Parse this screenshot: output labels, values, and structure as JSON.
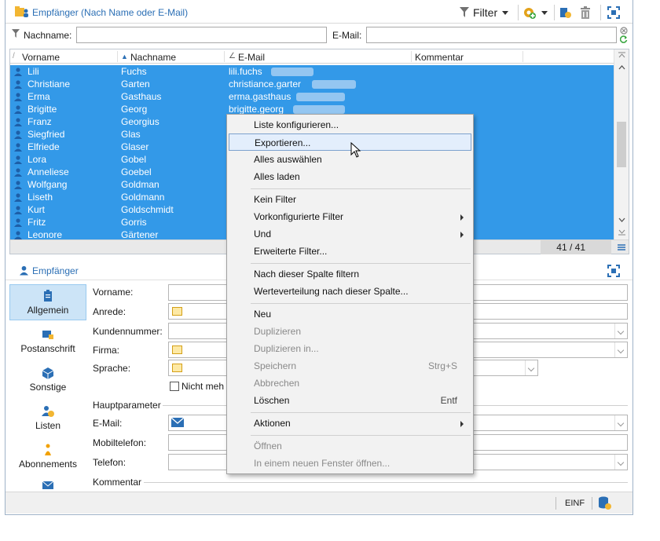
{
  "header": {
    "title": "Empfänger (Nach Name oder E-Mail)",
    "filter_label": "Filter"
  },
  "filter_row": {
    "last_name_label": "Nachname:",
    "last_name_value": "",
    "email_label": "E-Mail:",
    "email_value": ""
  },
  "grid": {
    "columns": [
      "Vorname",
      "Nachname",
      "E-Mail",
      "Kommentar"
    ],
    "rows": [
      {
        "first": "Lili",
        "last": "Fuchs",
        "email": "lili.fuchs"
      },
      {
        "first": "Christiane",
        "last": "Garten",
        "email": "christiance.garter"
      },
      {
        "first": "Erma",
        "last": "Gasthaus",
        "email": "erma.gasthaus"
      },
      {
        "first": "Brigitte",
        "last": "Georg",
        "email": "brigitte.georg"
      },
      {
        "first": "Franz",
        "last": "Georgius",
        "email": ""
      },
      {
        "first": "Siegfried",
        "last": "Glas",
        "email": ""
      },
      {
        "first": "Elfriede",
        "last": "Glaser",
        "email": ""
      },
      {
        "first": "Lora",
        "last": "Gobel",
        "email": ""
      },
      {
        "first": "Anneliese",
        "last": "Goebel",
        "email": ""
      },
      {
        "first": "Wolfgang",
        "last": "Goldman",
        "email": ""
      },
      {
        "first": "Liseth",
        "last": "Goldmann",
        "email": ""
      },
      {
        "first": "Kurt",
        "last": "Goldschmidt",
        "email": ""
      },
      {
        "first": "Fritz",
        "last": "Gorris",
        "email": ""
      },
      {
        "first": "Leonore",
        "last": "Gärtener",
        "email": ""
      }
    ],
    "count": "41 / 41"
  },
  "detail": {
    "title": "Empfänger",
    "sidebar": [
      "Allgemein",
      "Postanschrift",
      "Sonstige",
      "Listen",
      "Abonnements"
    ],
    "fields": {
      "vorname": "Vorname:",
      "anrede": "Anrede:",
      "kundennummer": "Kundennummer:",
      "firma": "Firma:",
      "sprache": "Sprache:",
      "nicht_mehr": "Nicht meh",
      "hauptparameter": "Hauptparameter",
      "email": "E-Mail:",
      "mobiltelefon": "Mobiltelefon:",
      "telefon": "Telefon:",
      "kommentar": "Kommentar"
    }
  },
  "status": {
    "mode": "EINF"
  },
  "context_menu": {
    "items": [
      {
        "label": "Liste konfigurieren...",
        "shortcut": "",
        "disabled": false,
        "submenu": false
      },
      {
        "label": "Exportieren...",
        "shortcut": "",
        "disabled": false,
        "submenu": false,
        "highlighted": true
      },
      {
        "label": "Alles auswählen",
        "shortcut": "",
        "disabled": false,
        "submenu": false
      },
      {
        "label": "Alles laden",
        "shortcut": "",
        "disabled": false,
        "submenu": false
      },
      {
        "label": "Kein Filter",
        "shortcut": "",
        "disabled": false,
        "submenu": false
      },
      {
        "label": "Vorkonfigurierte Filter",
        "shortcut": "",
        "disabled": false,
        "submenu": true
      },
      {
        "label": "Und",
        "shortcut": "",
        "disabled": false,
        "submenu": true
      },
      {
        "label": "Erweiterte Filter...",
        "shortcut": "",
        "disabled": false,
        "submenu": false
      },
      {
        "label": "Nach dieser Spalte filtern",
        "shortcut": "",
        "disabled": false,
        "submenu": false
      },
      {
        "label": "Werteverteilung nach dieser Spalte...",
        "shortcut": "",
        "disabled": false,
        "submenu": false
      },
      {
        "label": "Neu",
        "shortcut": "",
        "disabled": false,
        "submenu": false
      },
      {
        "label": "Duplizieren",
        "shortcut": "",
        "disabled": true,
        "submenu": false
      },
      {
        "label": "Duplizieren in...",
        "shortcut": "",
        "disabled": true,
        "submenu": false
      },
      {
        "label": "Speichern",
        "shortcut": "Strg+S",
        "disabled": true,
        "submenu": false
      },
      {
        "label": "Abbrechen",
        "shortcut": "",
        "disabled": true,
        "submenu": false
      },
      {
        "label": "Löschen",
        "shortcut": "Entf",
        "disabled": false,
        "submenu": false
      },
      {
        "label": "Aktionen",
        "shortcut": "",
        "disabled": false,
        "submenu": true
      },
      {
        "label": "Öffnen",
        "shortcut": "",
        "disabled": true,
        "submenu": false
      },
      {
        "label": "In einem neuen Fenster öffnen...",
        "shortcut": "",
        "disabled": true,
        "submenu": false
      }
    ]
  },
  "colors": {
    "accent": "#2b6fb5",
    "selection": "#3399e8",
    "menu_highlight": "#e3eefc"
  }
}
